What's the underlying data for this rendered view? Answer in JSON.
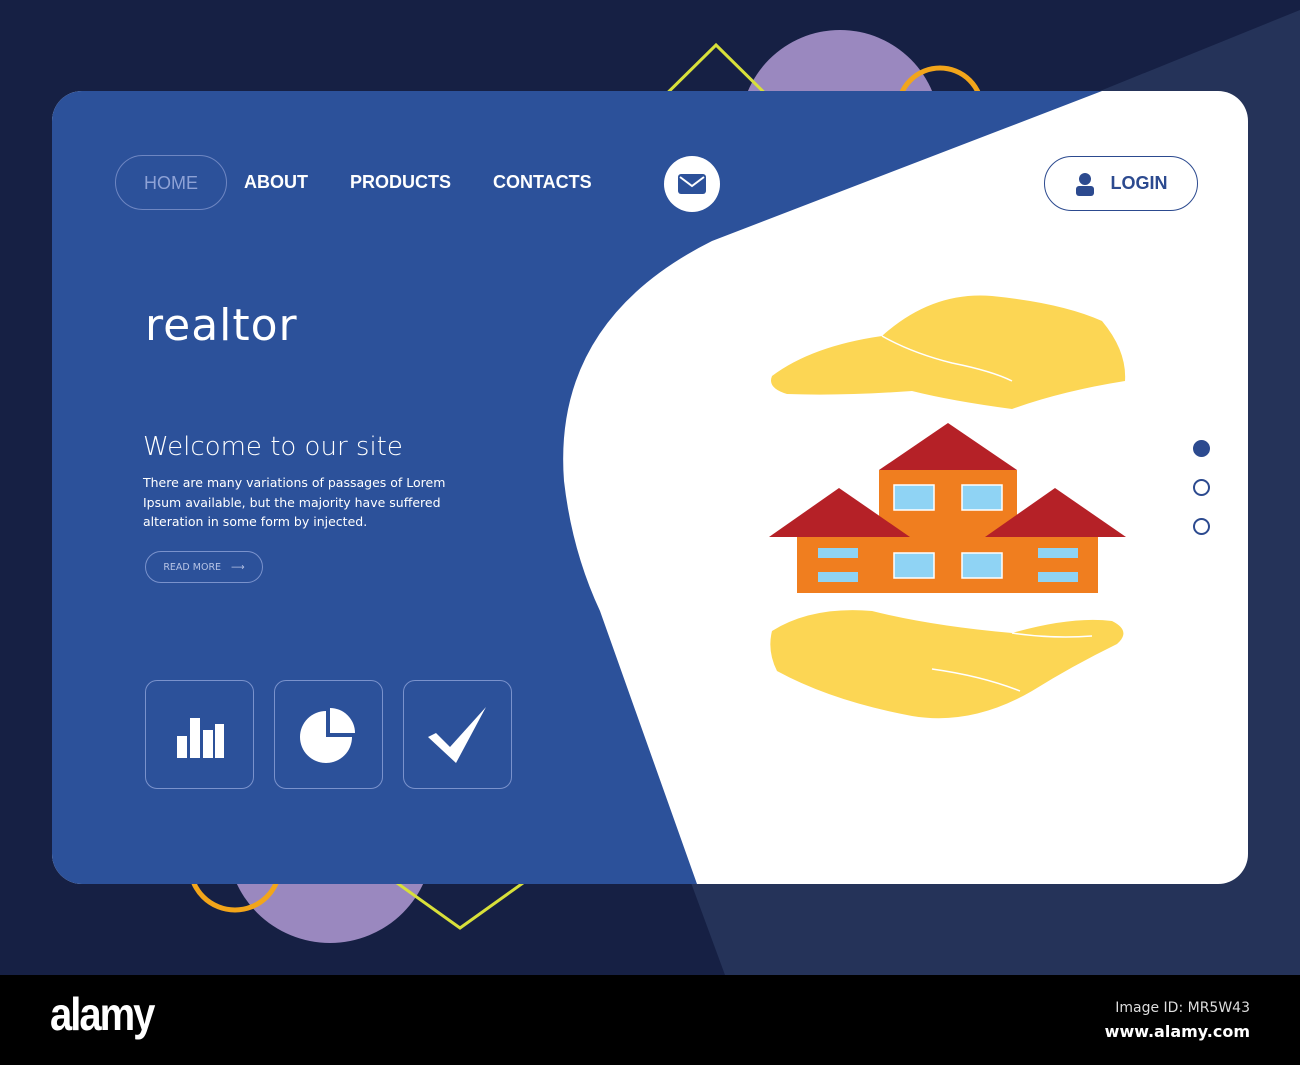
{
  "nav": {
    "items": [
      "HOME",
      "ABOUT",
      "PRODUCTS",
      "CONTACTS"
    ],
    "active": "HOME",
    "login_label": "LOGIN"
  },
  "hero": {
    "title": "realtor",
    "welcome": "Welcome to our site",
    "description": "There are many variations of passages of Lorem Ipsum available, but the majority have suffered alteration in some form by injected.",
    "read_more": "READ MORE"
  },
  "features": [
    "bar-chart-icon",
    "pie-chart-icon",
    "checkmark-icon"
  ],
  "slider": {
    "count": 3,
    "active": 1
  },
  "colors": {
    "background": "#162044",
    "primary": "#2c519a",
    "accent_purple": "#9a88bf",
    "accent_yellow": "#d8e03a",
    "accent_orange": "#f2a51a",
    "hand": "#fcd654",
    "roof": "#b52127",
    "house": "#f07e1f",
    "window": "#8fd3f4"
  },
  "footer": {
    "logo": "alamy",
    "image_id": "Image ID: MR5W43",
    "site": "www.alamy.com"
  }
}
